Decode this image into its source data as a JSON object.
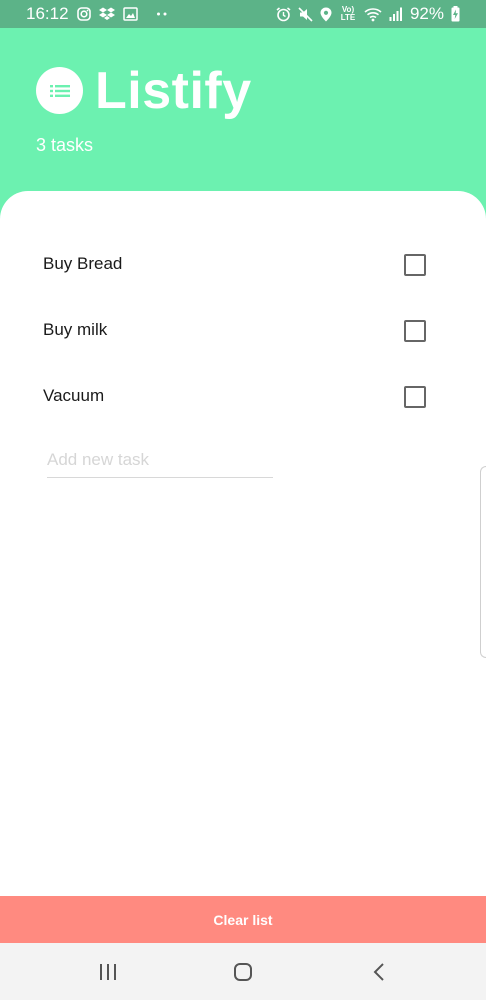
{
  "status_bar": {
    "time": "16:12",
    "battery": "92%",
    "network": "Vo) LTE",
    "icons_left": [
      "instagram-icon",
      "dropbox-icon",
      "image-icon",
      "more-dots-icon"
    ],
    "icons_right": [
      "alarm-icon",
      "mute-icon",
      "location-icon",
      "volte-icon",
      "wifi-icon",
      "signal-icon",
      "battery-charging-icon"
    ]
  },
  "header": {
    "title": "Listify",
    "task_count": "3 tasks",
    "logo_icon": "list-icon"
  },
  "tasks": [
    {
      "label": "Buy Bread",
      "checked": false
    },
    {
      "label": "Buy milk",
      "checked": false
    },
    {
      "label": "Vacuum",
      "checked": false
    }
  ],
  "add_task": {
    "placeholder": "Add new task",
    "value": ""
  },
  "footer": {
    "clear_label": "Clear list"
  },
  "nav_bar": {
    "buttons": [
      "recent-apps-icon",
      "home-icon",
      "back-icon"
    ]
  },
  "colors": {
    "status_bar": "#5cb388",
    "header": "#6cf1b0",
    "clear_button": "#ff8a80",
    "nav_bar": "#f3f3f3"
  }
}
